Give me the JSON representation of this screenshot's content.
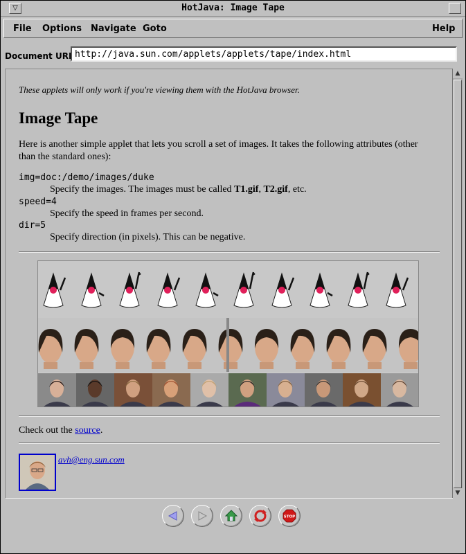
{
  "window": {
    "title": "HotJava: Image Tape"
  },
  "menubar": {
    "file": "File",
    "options": "Options",
    "navigate": "Navigate",
    "goto": "Goto",
    "help": "Help"
  },
  "address": {
    "label": "Document URL:",
    "url": "http://java.sun.com/applets/applets/tape/index.html"
  },
  "page": {
    "note": "These applets will only work if you're viewing them with the HotJava browser.",
    "heading": "Image Tape",
    "intro": "Here is another simple applet that lets you scroll a set of images. It takes the following attributes (other than the standard ones):",
    "attributes": [
      {
        "name": "img=doc:/demo/images/duke",
        "desc_prefix": "Specify the images. The images must be called ",
        "b1": "T1.gif",
        "sep": ", ",
        "b2": "T2.gif",
        "desc_suffix": ", etc."
      },
      {
        "name": "speed=4",
        "desc": "Specify the speed in frames per second."
      },
      {
        "name": "dir=5",
        "desc": "Specify direction (in pixels). This can be negative."
      }
    ],
    "check_prefix": "Check out the ",
    "source_link": "source",
    "check_suffix": ".",
    "email": "avh@eng.sun.com"
  },
  "toolbar": {
    "buttons": [
      "back-icon",
      "forward-icon",
      "home-icon",
      "reload-icon",
      "stop-icon"
    ],
    "stop_text": "STOP"
  },
  "colors": {
    "link": "#0000cc",
    "background": "#c0c0c0",
    "duke_nose": "#e0205a"
  }
}
